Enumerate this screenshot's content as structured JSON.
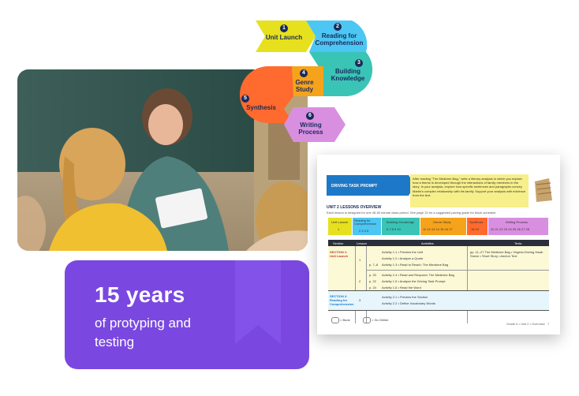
{
  "card": {
    "headline": "15 years",
    "subline": "of protyping and testing",
    "color": "#7a48e0"
  },
  "flow": {
    "steps": [
      {
        "num": "1",
        "label": "Unit Launch",
        "color": "#e6e01e"
      },
      {
        "num": "2",
        "label": "Reading for Comprehension",
        "color": "#4cc6f2"
      },
      {
        "num": "3",
        "label": "Building Knowledge",
        "color": "#39c4b6"
      },
      {
        "num": "4",
        "label": "Genre Study",
        "color": "#f6a31c"
      },
      {
        "num": "5",
        "label": "Synthesis",
        "color": "#ff6a2e"
      },
      {
        "num": "6",
        "label": "Writing Process",
        "color": "#d98fe0"
      }
    ]
  },
  "doc": {
    "driving_title": "DRIVING TASK PROMPT",
    "prompt_text": "After reading \"The Medicine Bag,\" write a literary analysis in which you explain how a theme is developed through the interactions of family members in the story. In your analysis, explore how specific sentences and paragraphs convey Martin's complex relationship with his family. Support your analysis with evidence from the text.",
    "overview_title": "UNIT 2 LESSONS OVERVIEW",
    "overview_note": "Each lesson is designed for one 45-50 minute class period. See page 13 for a suggested pacing guide for block schedule.",
    "stages": [
      {
        "label": "Unit Launch",
        "lessons": "1"
      },
      {
        "label": "Reading for Comprehension",
        "lessons": "2 3 4 5"
      },
      {
        "label": "Building Knowledge",
        "lessons": "6 7 8 9 10"
      },
      {
        "label": "Genre Study",
        "lessons": "11 12 13 14 15 16 17"
      },
      {
        "label": "Synthesis",
        "lessons": "18 19"
      },
      {
        "label": "Writing Process",
        "lessons": "20 21 22 23 24 25 26 27 28"
      }
    ],
    "table_headers": [
      "Section",
      "Lesson",
      "Activities",
      "Texts"
    ],
    "sections": [
      {
        "section": "SECTION 1: Unit Launch",
        "lessons": [
          {
            "num": "1",
            "rows": [
              {
                "page": "",
                "activity": "Activity 1.1 • Preview the Unit"
              },
              {
                "page": "",
                "activity": "Activity 1.2 • Analyze a Quote"
              },
              {
                "page": "p. 7–8",
                "activity": "Activity 1.3 • Read to Reach: The Medicine Bag"
              }
            ],
            "texts": "pp. 11–27 The Medicine Bag • Virginia Driving Hawk Sneve • Short Story • Anchor Text"
          },
          {
            "num": "2",
            "rows": [
              {
                "page": "p. 20",
                "activity": "Activity 1.4 • Read and Respond: The Medicine Bag"
              },
              {
                "page": "p. 22",
                "activity": "Activity 1.5 • Analyze the Driving Task Prompt"
              },
              {
                "page": "p. 24",
                "activity": "Activity 1.6 • Read the Word"
              }
            ],
            "texts": ""
          }
        ]
      },
      {
        "section": "SECTION 2: Reading for Comprehension",
        "lessons": [
          {
            "num": "3",
            "rows": [
              {
                "page": "",
                "activity": "Activity 2.1 • Preview the Section"
              },
              {
                "page": "",
                "activity": "Activity 2.2 • Define Vocabulary Words"
              }
            ],
            "texts": ""
          }
        ]
      }
    ],
    "legend_book": "= Book",
    "legend_online": "= Go Online",
    "footer": "Grade 6 • Unit 2 • Overview",
    "page_number": "7"
  }
}
